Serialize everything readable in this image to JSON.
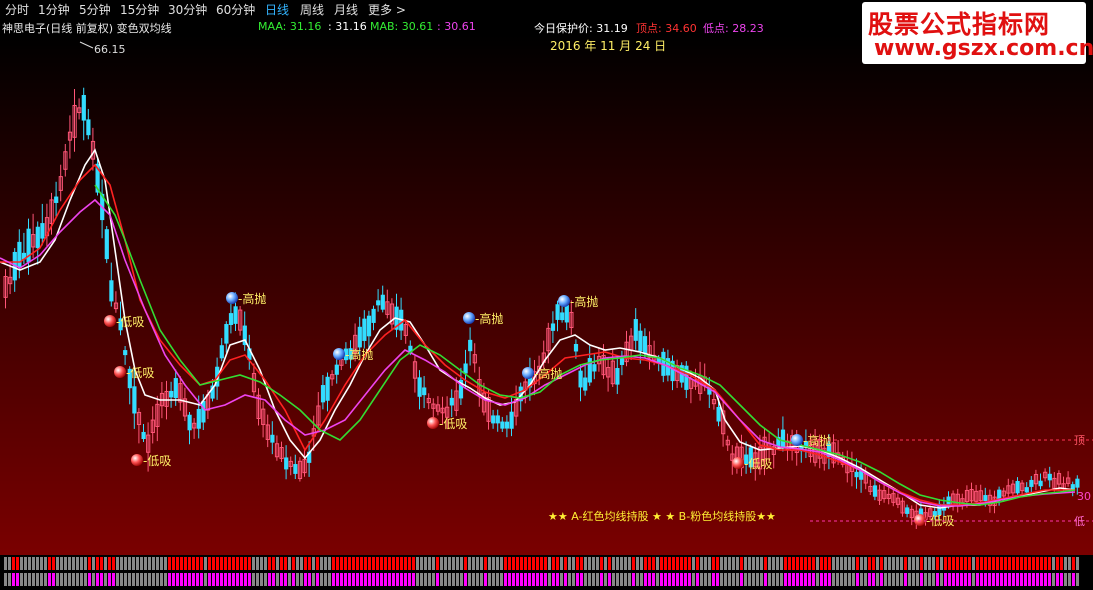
{
  "toolbar": {
    "periods": [
      "分时",
      "1分钟",
      "5分钟",
      "15分钟",
      "30分钟",
      "60分钟",
      "日线",
      "周线",
      "月线",
      "更多 >"
    ],
    "active_index": 6
  },
  "info": {
    "stock": "神思电子(日线 前复权) 变色双均线",
    "maa_label": "MAA: 31.16",
    "maa_value": ": 31.16",
    "mab_label": "MAB: 30.61",
    "mab_value": ": 30.61",
    "protect_label": "今日保护价: 31.19",
    "top_label": "顶点: 34.60",
    "bottom_label": "低点: 28.23"
  },
  "chart_data": {
    "type": "candlestick",
    "date_label": "2016 年 11 月 24 日",
    "high_price_label": "66.15",
    "legend_text": "★★ A-红色均线持股 ★ ★ B-粉色均线持股★★",
    "right_labels": [
      "顶",
      "30",
      "低"
    ],
    "signal_labels": {
      "sell": "高抛",
      "buy": "低吸"
    },
    "colors": {
      "background_top": "#000000",
      "background_bottom": "#7a0000",
      "up": "#ff5577",
      "down": "#33ddff",
      "line_white": "#ffffff",
      "line_red": "#ff2222",
      "line_magenta": "#ee44ee",
      "line_green": "#33dd33",
      "bar_red": "#ff0000",
      "bar_magenta": "#ff00ff",
      "bar_gray": "#888888"
    }
  },
  "watermark": {
    "line1": "股票公式指标网",
    "line2": "www.gszx.com.cn"
  }
}
